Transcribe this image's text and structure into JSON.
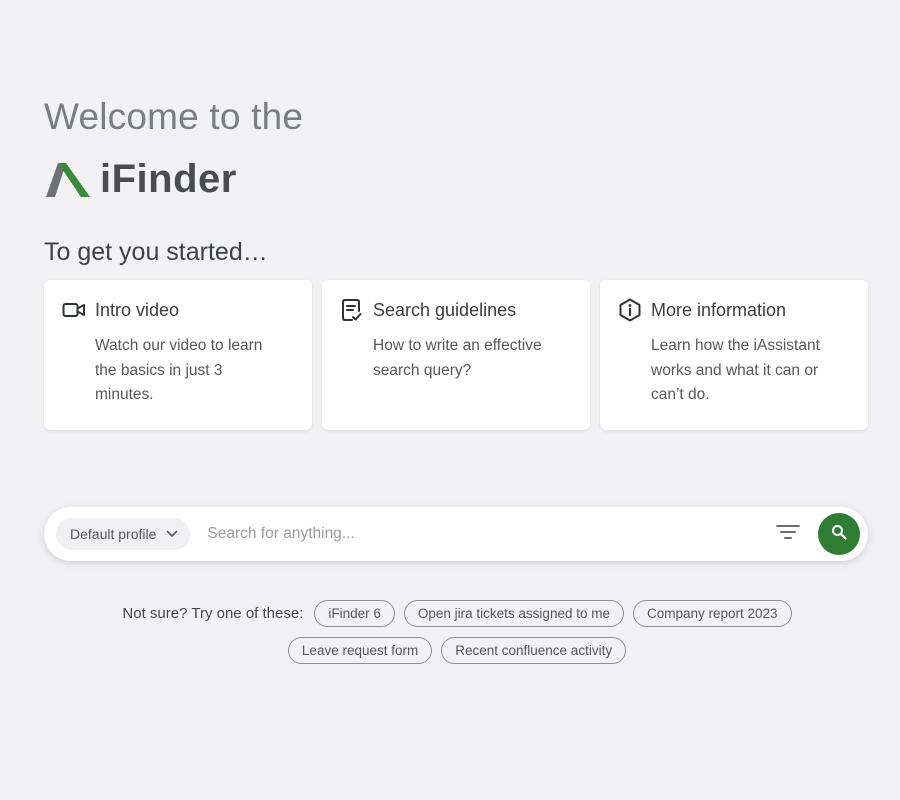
{
  "header": {
    "welcome": "Welcome to the",
    "logo_text": "iFinder",
    "brand_color": "#3a8a3a"
  },
  "intro": {
    "heading": "To get you started…"
  },
  "cards": [
    {
      "icon": "video-camera-icon",
      "title": "Intro video",
      "description": "Watch our video to learn the basics in just 3 minutes."
    },
    {
      "icon": "guidelines-document-icon",
      "title": "Search guidelines",
      "description": "How to write an effective search query?"
    },
    {
      "icon": "info-hexagon-icon",
      "title": "More information",
      "description": "Learn how the iAssistant works and what it can or can’t do."
    }
  ],
  "search": {
    "profile_label": "Default profile",
    "placeholder": "Search for anything...",
    "value": "",
    "filter_icon": "filter-icon",
    "submit_icon": "search-icon",
    "accent_color": "#2e7d32"
  },
  "suggestions": {
    "label": "Not sure? Try one of these:",
    "row1": [
      "iFinder 6",
      "Open jira tickets assigned to me",
      "Company report 2023"
    ],
    "row2": [
      "Leave request form",
      "Recent confluence activity"
    ]
  }
}
